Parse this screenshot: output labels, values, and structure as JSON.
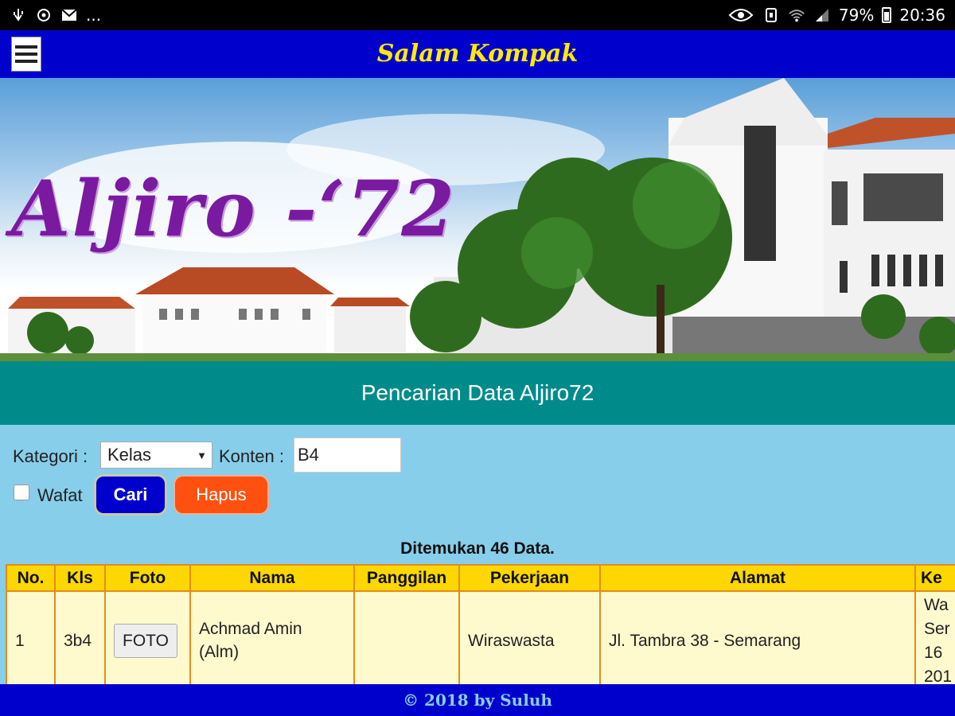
{
  "status_bar": {
    "left_icons": [
      "usb-icon",
      "sync-icon",
      "mail-icon"
    ],
    "more": "...",
    "right_icons": [
      "eye-icon",
      "nfc-icon",
      "wifi-icon",
      "signal-icon"
    ],
    "battery": "79%",
    "time": "20:36"
  },
  "app": {
    "title": "Salam Kompak"
  },
  "banner": {
    "title": "Aljiro -‘72"
  },
  "section": {
    "title": "Pencarian Data Aljiro72"
  },
  "form": {
    "kategori_label": "Kategori :",
    "kategori_value": "Kelas",
    "konten_label": "Konten :",
    "konten_value": "B4",
    "wafat_label": "Wafat",
    "wafat_checked": false,
    "cari_label": "Cari",
    "hapus_label": "Hapus"
  },
  "results": {
    "count_text": "Ditemukan 46 Data.",
    "columns": [
      "No.",
      "Kls",
      "Foto",
      "Nama",
      "Panggilan",
      "Pekerjaan",
      "Alamat",
      "Ke"
    ],
    "rows": [
      {
        "no": "1",
        "kls": "3b4",
        "foto": "FOTO",
        "nama": "Achmad Amin (Alm)",
        "panggilan": "",
        "pekerjaan": "Wiraswasta",
        "alamat": "Jl. Tambra 38 - Semarang",
        "ke": "Wa Ser 16 201"
      }
    ]
  },
  "footer": {
    "text": "© 2018 by Suluh"
  },
  "colors": {
    "header_blue": "#0000cc",
    "title_yellow": "#ffeb00",
    "section_teal": "#008b8b",
    "page_bg": "#87ceeb",
    "table_header": "#ffd700",
    "table_cell": "#fffacd",
    "table_border": "#e88a1c",
    "hapus_orange": "#ff5010"
  }
}
